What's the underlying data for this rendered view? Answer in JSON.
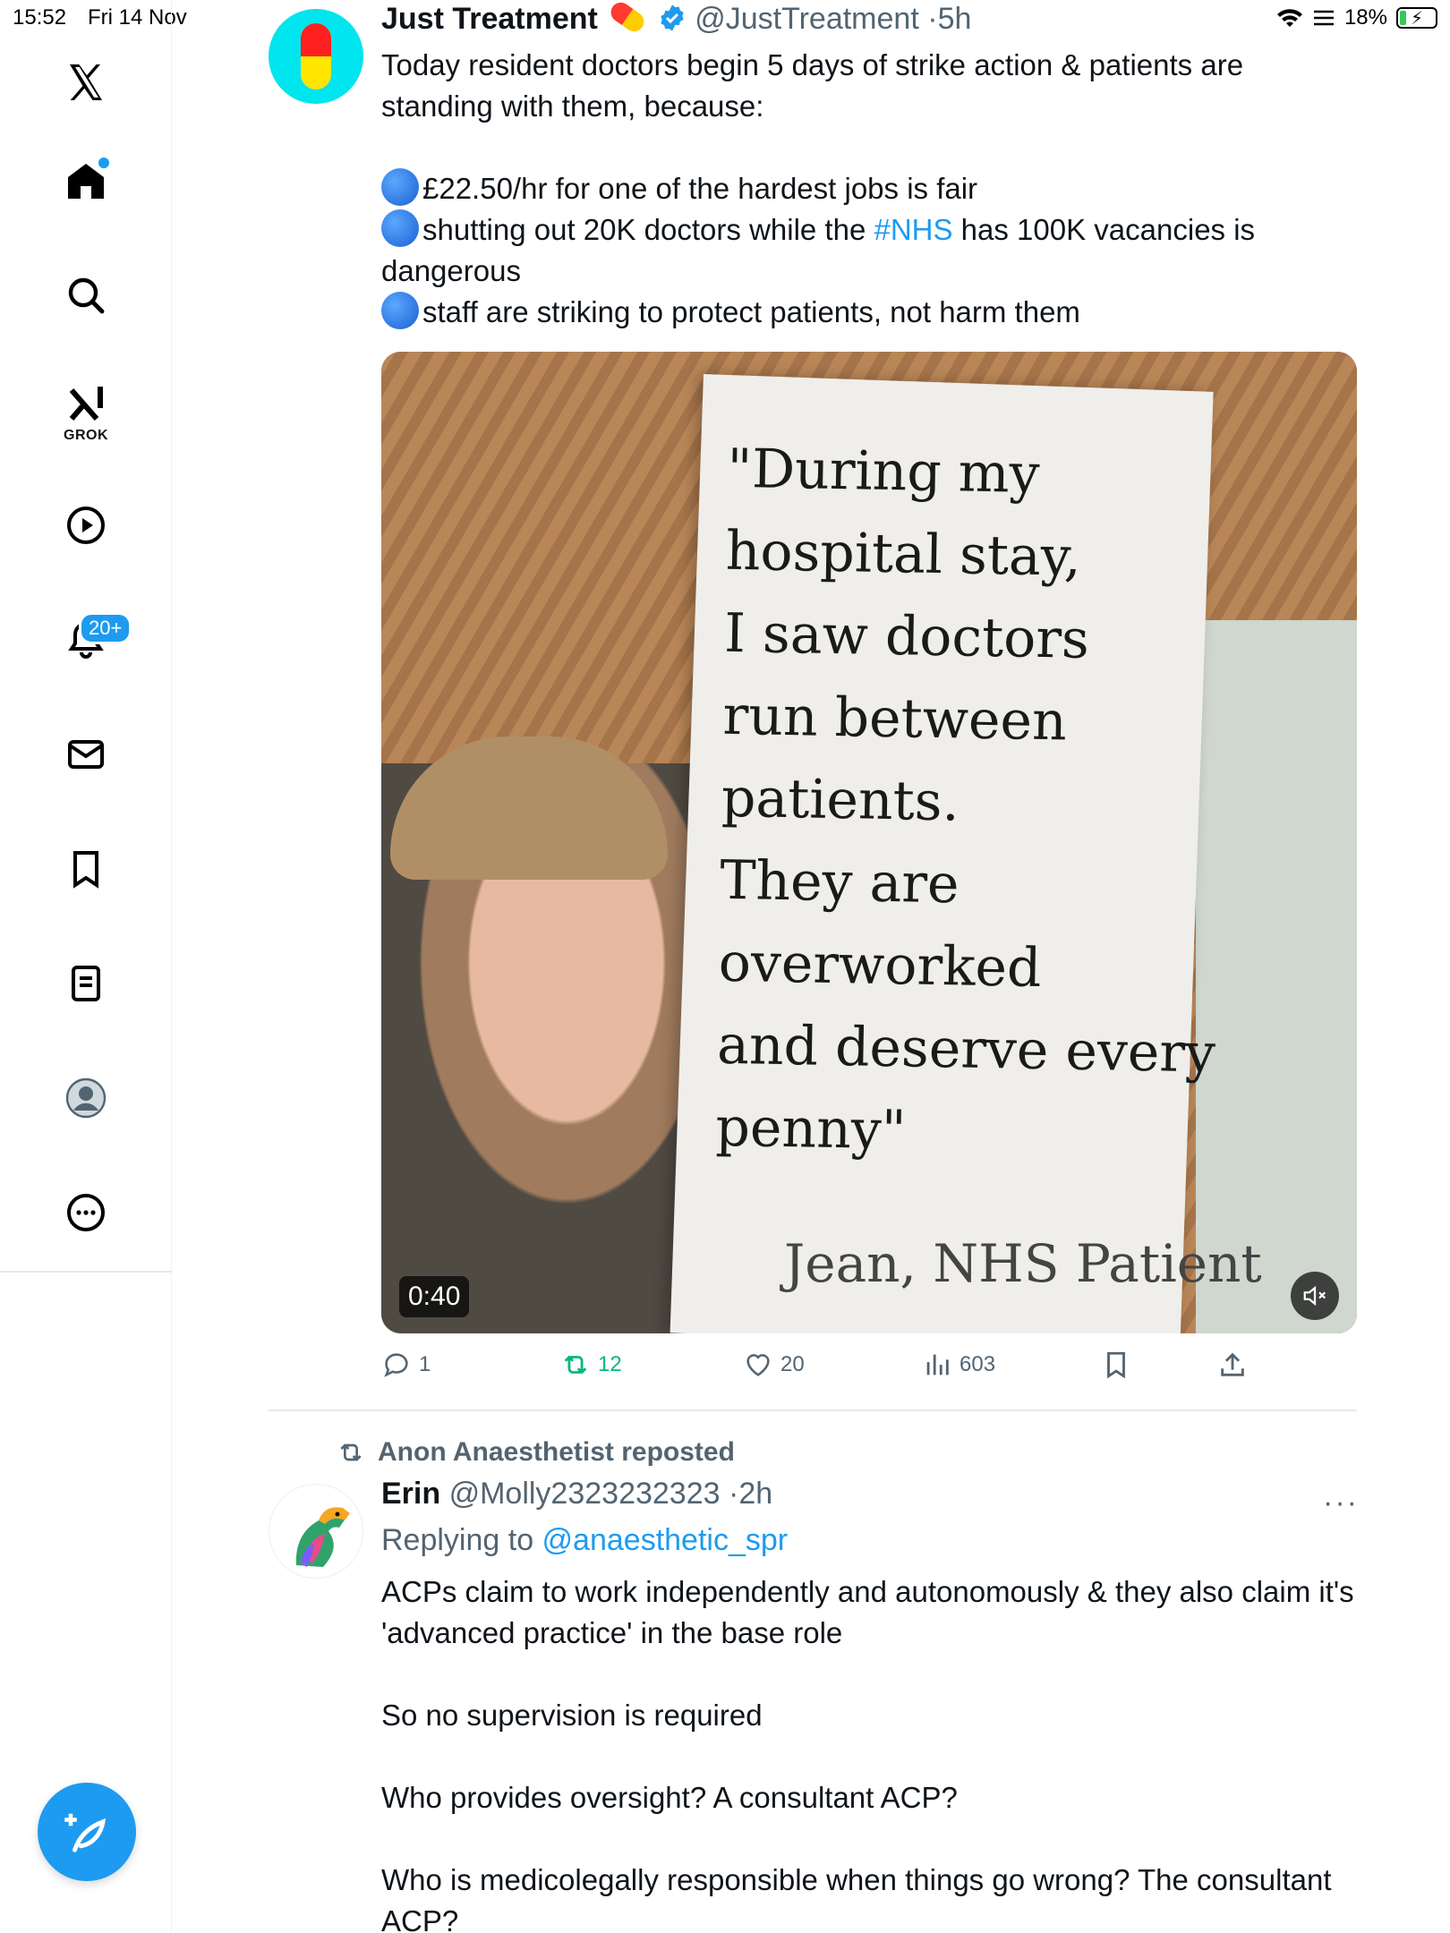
{
  "status_bar": {
    "time": "15:52",
    "date": "Fri 14 Nov",
    "battery": "18%",
    "battery_level": 0.18
  },
  "sidebar": {
    "items": [
      {
        "name": "x-logo"
      },
      {
        "name": "home"
      },
      {
        "name": "search"
      },
      {
        "name": "grok",
        "label": "GROK"
      },
      {
        "name": "video"
      },
      {
        "name": "notifications",
        "badge": "20+"
      },
      {
        "name": "messages"
      },
      {
        "name": "bookmarks"
      },
      {
        "name": "lists"
      },
      {
        "name": "profile"
      },
      {
        "name": "more"
      }
    ],
    "accent_color": "#1d9bf0"
  },
  "tweet1": {
    "name": "Just Treatment",
    "handle": "@JustTreatment",
    "time": "5h",
    "text_lead": "Today resident doctors begin 5 days of strike action & patients are standing with them, because:",
    "bullet1": "£22.50/hr for one of the hardest jobs is fair",
    "bullet2_pre": "shutting out 20K doctors while the ",
    "bullet2_link": "#NHS",
    "bullet2_post": " has 100K vacancies is dangerous",
    "bullet3": "staff are striking to protect patients, not harm them",
    "media": {
      "sign_text": "\"During my\nhospital stay,\nI saw doctors\nrun between\npatients.\nThey are overworked\nand deserve every\npenny\"",
      "sign_signature": "Jean, NHS Patient",
      "duration": "0:40"
    },
    "stats": {
      "replies": "1",
      "reposts": "12",
      "likes": "20",
      "views": "603"
    }
  },
  "tweet2": {
    "reposted_by": "Anon Anaesthetist reposted",
    "name": "Erin",
    "handle": "@Molly2323232323",
    "time": "2h",
    "replying_prefix": "Replying to ",
    "replying_to": "@anaesthetic_spr",
    "p1": "ACPs claim to work independently and autonomously & they also claim it's 'advanced practice' in the base role",
    "p2": "So no supervision is required",
    "p3": "Who provides oversight? A consultant ACP?",
    "p4": "Who is medicolegally responsible when things go wrong? The consultant ACP?"
  }
}
